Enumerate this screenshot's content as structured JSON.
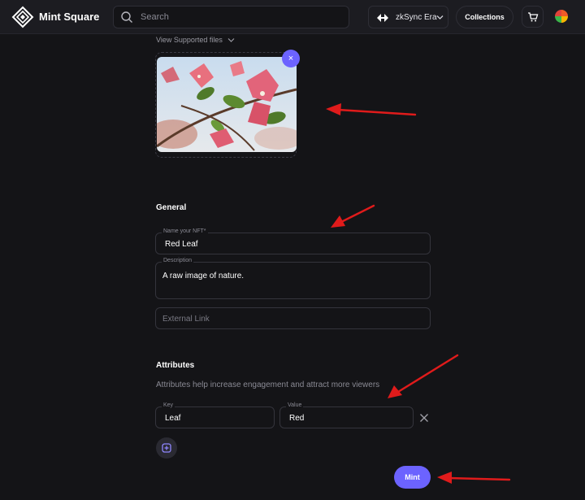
{
  "header": {
    "brand": "Mint Square",
    "search_placeholder": "Search",
    "network": "zkSync Era",
    "collections_label": "Collections"
  },
  "upload": {
    "supported_files_label": "View Supported files",
    "remove_symbol": "×"
  },
  "general": {
    "title": "General",
    "name_label": "Name your NFT*",
    "name_value": "Red Leaf",
    "description_label": "Description",
    "description_value": "A raw image of nature.",
    "external_link_placeholder": "External Link"
  },
  "attributes": {
    "title": "Attributes",
    "hint": "Attributes help increase engagement and attract more viewers",
    "key_label": "Key",
    "key_value": "Leaf",
    "value_label": "Value",
    "value_value": "Red"
  },
  "actions": {
    "mint_label": "Mint"
  },
  "colors": {
    "accent": "#6c63ff",
    "annotation_arrow": "#e01b1b",
    "background": "#141417",
    "header_bg": "#1c1c21"
  },
  "icons": [
    "mint-square-logo-icon",
    "search-icon",
    "network-swap-icon",
    "chevron-down-icon",
    "cart-icon",
    "close-icon",
    "plus-square-icon"
  ]
}
